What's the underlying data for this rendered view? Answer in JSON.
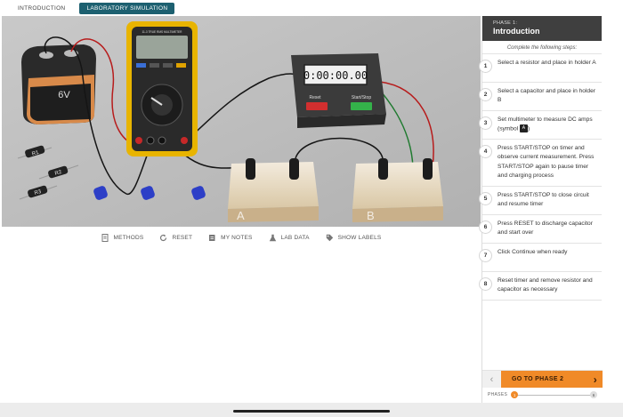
{
  "tabs": [
    {
      "label": "INTRODUCTION"
    },
    {
      "label": "LABORATORY SIMULATION"
    }
  ],
  "simulation": {
    "multimeter_brand": "11-3 TRUE RMS MULTIMETER",
    "battery_label": "6V",
    "timer_display": "0:00:00.00",
    "timer_reset_label": "Reset",
    "timer_startstop_label": "Start/Stop",
    "resistors": [
      "R1",
      "R2",
      "R3"
    ],
    "holders": [
      "A",
      "B"
    ]
  },
  "toolbar": [
    {
      "label": "METHODS",
      "icon": "methods-icon"
    },
    {
      "label": "RESET",
      "icon": "reset-icon"
    },
    {
      "label": "MY NOTES",
      "icon": "notes-icon"
    },
    {
      "label": "LAB DATA",
      "icon": "flask-icon"
    },
    {
      "label": "SHOW LABELS",
      "icon": "tag-icon"
    }
  ],
  "panel": {
    "phase_sub": "PHASE 1:",
    "phase_title": "Introduction",
    "instruction": "Complete the following steps:",
    "steps": [
      {
        "num": "1",
        "text": "Select a resistor and place in holder A"
      },
      {
        "num": "2",
        "text": "Select a capacitor and place in holder B"
      },
      {
        "num": "3",
        "text": "Set multimeter to measure DC amps (symbol",
        "symbol": "A",
        "after": ")"
      },
      {
        "num": "4",
        "text": "Press START/STOP on timer and observe current measurement. Press START/STOP again to pause timer and charging process"
      },
      {
        "num": "5",
        "text": "Press START/STOP to close circuit and resume timer"
      },
      {
        "num": "6",
        "text": "Press RESET to discharge capacitor and start over"
      },
      {
        "num": "7",
        "text": "Click Continue when ready"
      },
      {
        "num": "8",
        "text": "Reset timer and remove resistor and capacitor as necessary"
      }
    ],
    "next_label": "GO TO PHASE 2",
    "phases_label": "PHASES",
    "phase_current": "1",
    "phase_last": "6"
  },
  "colors": {
    "accent": "#1d6070",
    "orange": "#f08a28",
    "panel_head": "#3f3f3f"
  }
}
